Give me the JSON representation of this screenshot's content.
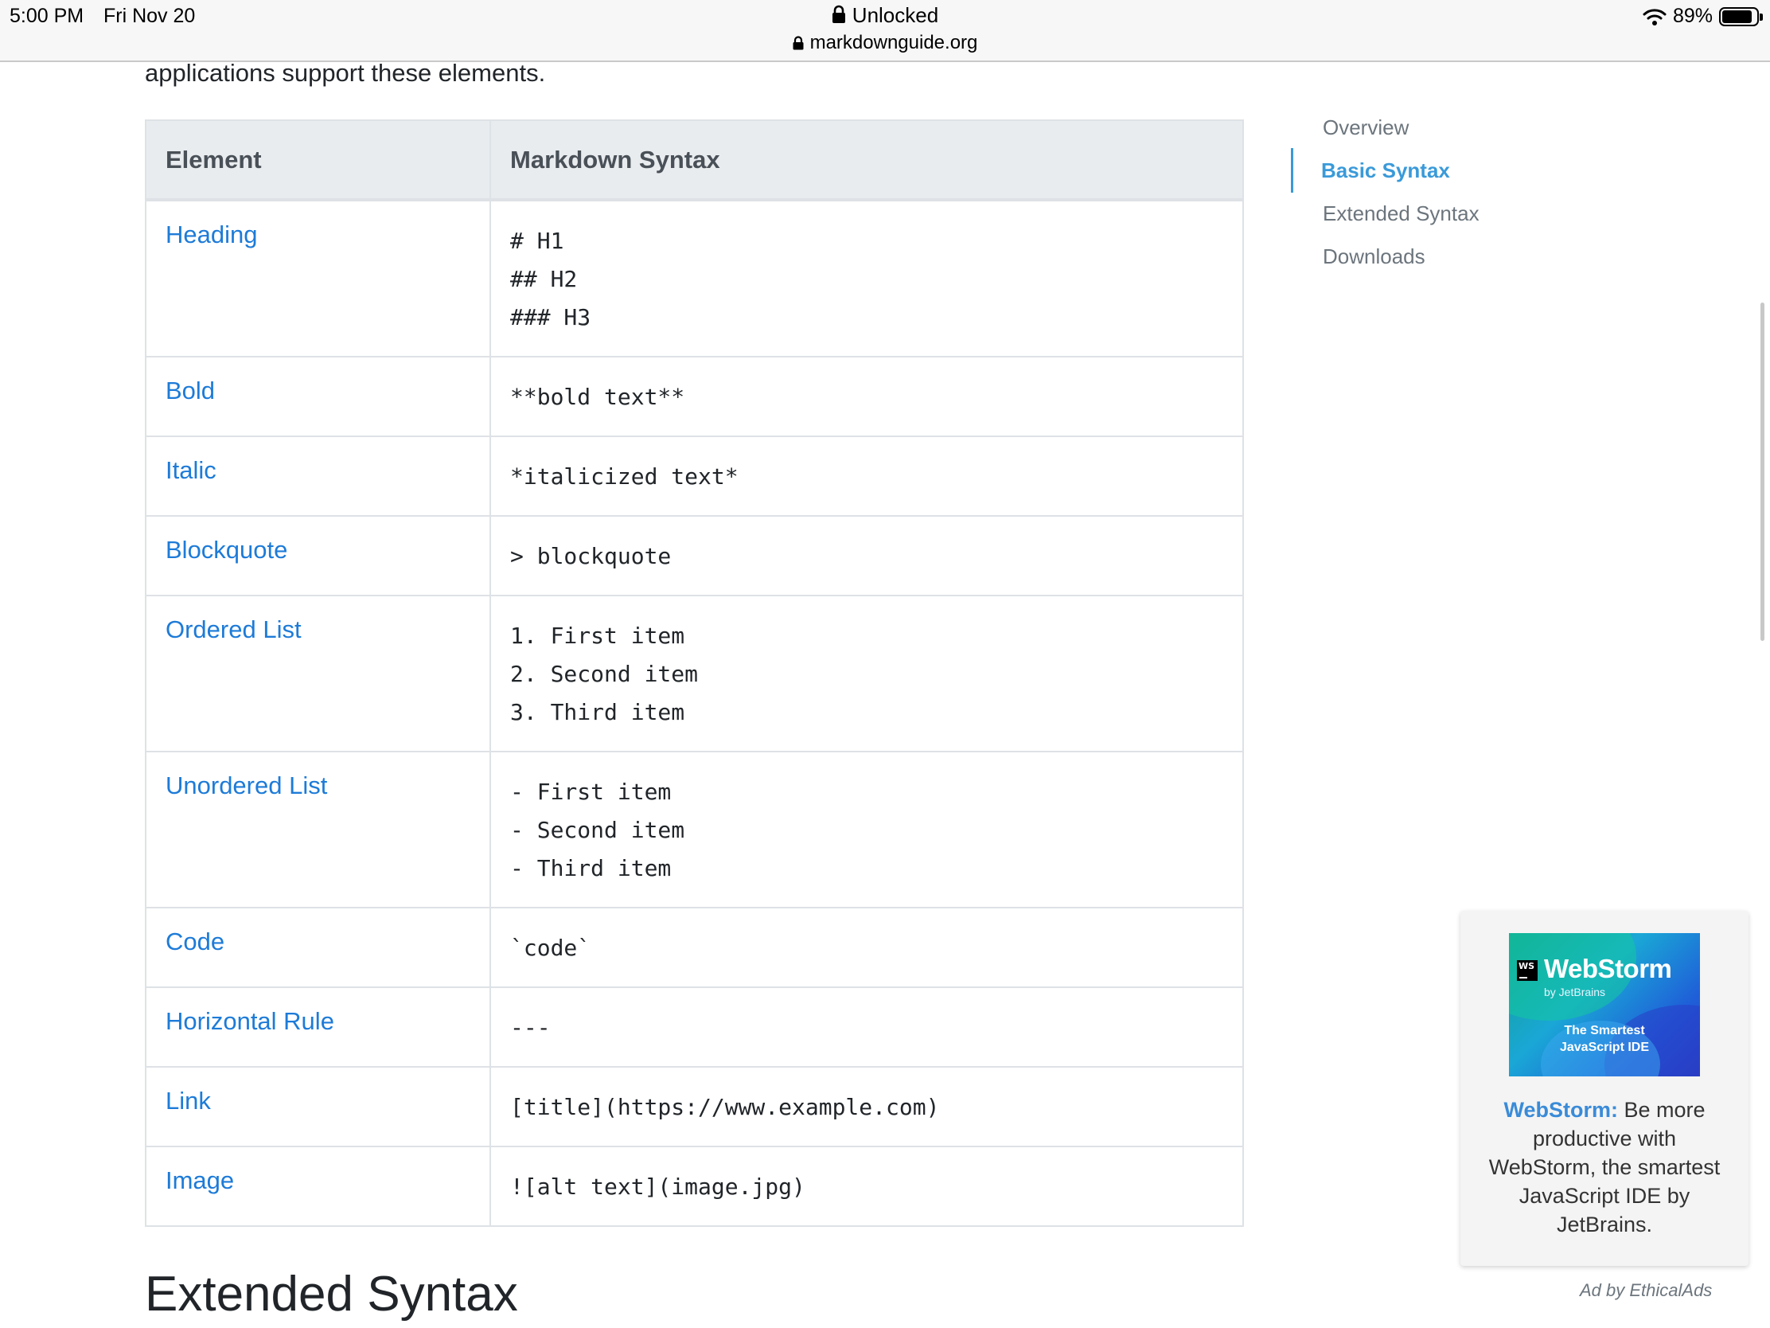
{
  "status_bar": {
    "time": "5:00 PM",
    "date": "Fri Nov 20",
    "lock_status": "Unlocked",
    "url": "markdownguide.org",
    "battery": "89%",
    "battery_level": 0.89
  },
  "intro_text": "applications support these elements.",
  "table": {
    "headers": {
      "element": "Element",
      "syntax": "Markdown Syntax"
    },
    "rows": [
      {
        "element": "Heading",
        "lines": [
          "# H1",
          "## H2",
          "### H3"
        ]
      },
      {
        "element": "Bold",
        "lines": [
          "**bold text**"
        ]
      },
      {
        "element": "Italic",
        "lines": [
          "*italicized text*"
        ]
      },
      {
        "element": "Blockquote",
        "lines": [
          "> blockquote"
        ]
      },
      {
        "element": "Ordered List",
        "lines": [
          "1. First item",
          "2. Second item",
          "3. Third item"
        ]
      },
      {
        "element": "Unordered List",
        "lines": [
          "- First item",
          "- Second item",
          "- Third item"
        ]
      },
      {
        "element": "Code",
        "lines": [
          "`code`"
        ]
      },
      {
        "element": "Horizontal Rule",
        "lines": [
          "---"
        ]
      },
      {
        "element": "Link",
        "lines": [
          "[title](https://www.example.com)"
        ]
      },
      {
        "element": "Image",
        "lines": [
          "![alt text](image.jpg)"
        ]
      }
    ]
  },
  "section_heading": "Extended Syntax",
  "toc": {
    "items": [
      {
        "label": "Overview",
        "active": false
      },
      {
        "label": "Basic Syntax",
        "active": true
      },
      {
        "label": "Extended Syntax",
        "active": false
      },
      {
        "label": "Downloads",
        "active": false
      }
    ]
  },
  "ad": {
    "image_brand": "WebStorm",
    "image_logo": "WS",
    "image_by": "by JetBrains",
    "image_tagline_1": "The Smartest",
    "image_tagline_2": "JavaScript IDE",
    "headline": "WebStorm:",
    "body": "Be more productive with WebStorm, the smartest JavaScript IDE by JetBrains.",
    "credit": "Ad by EthicalAds"
  },
  "colors": {
    "link": "#1d7bd8",
    "toc_active": "#3a9ad9",
    "table_header_bg": "#e9ecef",
    "border": "#dee2e6"
  }
}
